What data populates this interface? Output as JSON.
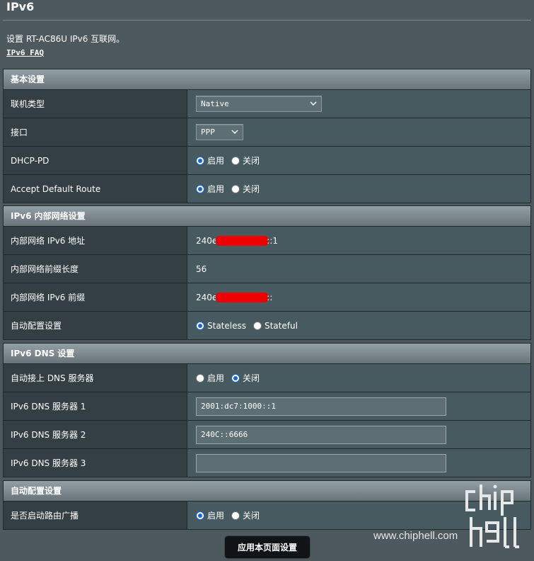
{
  "page": {
    "title": "IPv6",
    "description": "设置 RT-AC86U IPv6 互联网。",
    "faq_link": "IPv6 FAQ"
  },
  "basic": {
    "header": "基本设置",
    "connection_type": {
      "label": "联机类型",
      "value": "Native"
    },
    "interface": {
      "label": "接口",
      "value": "PPP"
    },
    "dhcp_pd": {
      "label": "DHCP-PD",
      "opt_on": "启用",
      "opt_off": "关闭",
      "selected": "启用"
    },
    "default_route": {
      "label": "Accept Default Route",
      "opt_on": "启用",
      "opt_off": "关闭",
      "selected": "启用"
    }
  },
  "lan": {
    "header": "IPv6 内部网络设置",
    "address": {
      "label": "内部网络 IPv6 地址",
      "prefix_text": "240e",
      "suffix_text": "::1"
    },
    "prefix_length": {
      "label": "内部网络前缀长度",
      "value": "56"
    },
    "prefix": {
      "label": "内部网络 IPv6 前缀",
      "prefix_text": "240e",
      "suffix_text": "::"
    },
    "autoconf": {
      "label": "自动配置设置",
      "opt_a": "Stateless",
      "opt_b": "Stateful",
      "selected": "Stateless"
    }
  },
  "dns": {
    "header": "IPv6 DNS 设置",
    "auto": {
      "label": "自动接上 DNS 服务器",
      "opt_on": "启用",
      "opt_off": "关闭",
      "selected": "关闭"
    },
    "server1": {
      "label": "IPv6 DNS 服务器 1",
      "value": "2001:dc7:1000::1"
    },
    "server2": {
      "label": "IPv6 DNS 服务器 2",
      "value": "240C::6666"
    },
    "server3": {
      "label": "IPv6 DNS 服务器 3",
      "value": ""
    }
  },
  "autoconf_section": {
    "header": "自动配置设置",
    "ra": {
      "label": "是否启动路由广播",
      "opt_on": "启用",
      "opt_off": "关闭",
      "selected": "启用"
    }
  },
  "apply_button": "应用本页面设置",
  "watermark": {
    "text": "www.chiphell.com",
    "logo_text": "chip hell"
  },
  "colors": {
    "background": "#4d595d",
    "radio_selected": "#1a66d4",
    "redaction": "#ee0000"
  }
}
